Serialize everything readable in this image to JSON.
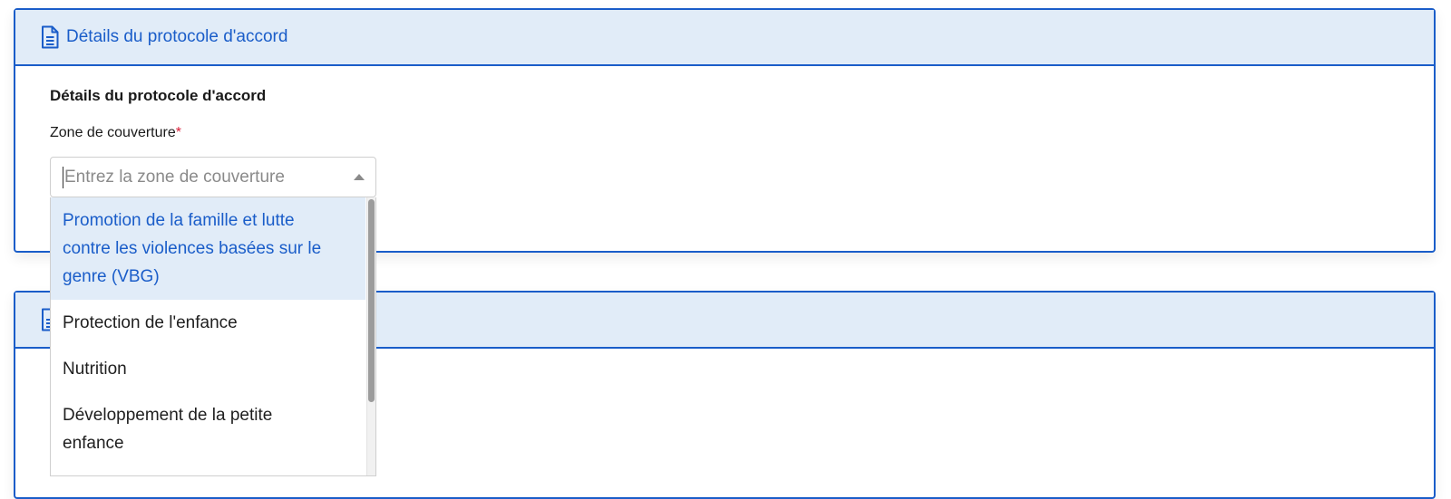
{
  "card1": {
    "header_title": "Détails du protocole d'accord",
    "section_title": "Détails du protocole d'accord",
    "field": {
      "label": "Zone de couverture",
      "required_mark": "*",
      "placeholder": "Entrez la zone de couverture",
      "value": ""
    }
  },
  "dropdown": {
    "options": [
      {
        "label": "Promotion de la famille et lutte contre les violences basées sur le genre (VBG)",
        "highlighted": true
      },
      {
        "label": "Protection de l'enfance",
        "highlighted": false
      },
      {
        "label": "Nutrition",
        "highlighted": false
      },
      {
        "label": "Développement de la petite enfance",
        "highlighted": false
      }
    ]
  },
  "icons": {
    "header_icon": "document-icon",
    "select_arrow": "caret-up-icon"
  },
  "colors": {
    "accent": "#1a5dc9",
    "header_bg": "#e1ecf8",
    "required": "#d9213a",
    "highlight_bg": "#e1ecf8"
  }
}
